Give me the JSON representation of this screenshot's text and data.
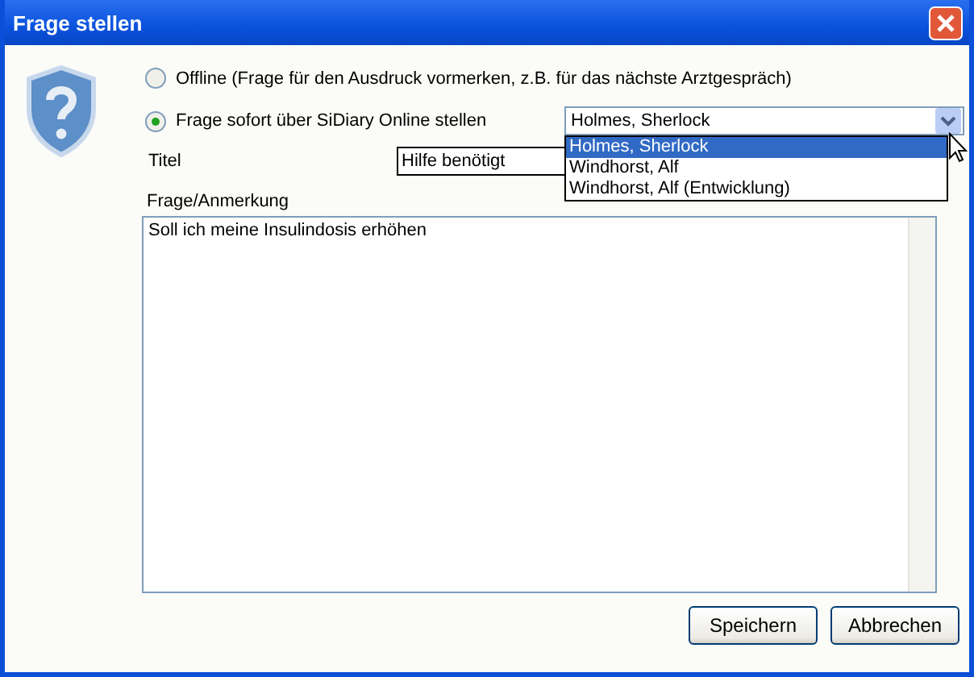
{
  "window": {
    "title": "Frage stellen"
  },
  "mode_options": [
    {
      "label": "Offline (Frage für den Ausdruck vormerken, z.B. für das nächste Arztgespräch)",
      "selected": false
    },
    {
      "label": "Frage sofort über SiDiary Online stellen",
      "selected": true
    }
  ],
  "recipient": {
    "value": "Holmes, Sherlock",
    "expanded": true,
    "options": [
      {
        "label": "Holmes, Sherlock",
        "selected": true
      },
      {
        "label": "Windhorst, Alf",
        "selected": false
      },
      {
        "label": "Windhorst, Alf (Entwicklung)",
        "selected": false
      }
    ]
  },
  "title_field": {
    "label": "Titel",
    "value": "Hilfe benötigt"
  },
  "note_field": {
    "label": "Frage/Anmerkung",
    "value": "Soll ich meine Insulindosis erhöhen"
  },
  "buttons": [
    "Speichern",
    "Abbrechen"
  ]
}
